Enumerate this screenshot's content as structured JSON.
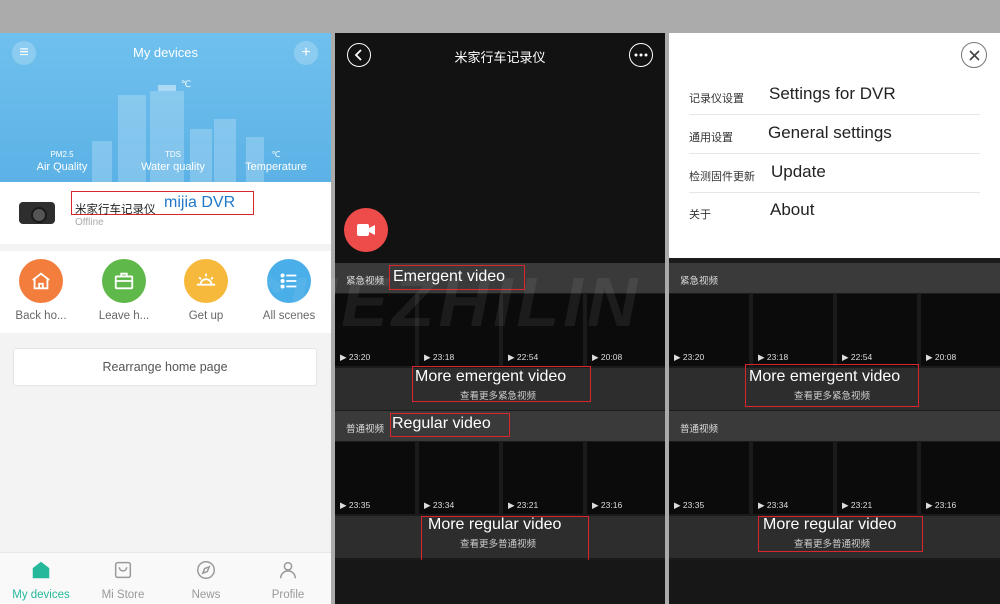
{
  "home": {
    "title": "My devices",
    "temp_unit": "℃",
    "metrics": [
      {
        "small": "PM2.5",
        "label": "Air Quality"
      },
      {
        "small": "TDS",
        "label": "Water quality"
      },
      {
        "small": "℃",
        "label": "Temperature"
      }
    ],
    "device": {
      "name_zh": "米家行车记录仪",
      "name_en": "mijia DVR",
      "status": "Offline"
    },
    "scenes": [
      {
        "label": "Back ho...",
        "color": "#f27d3d",
        "icon": "home-icon"
      },
      {
        "label": "Leave h...",
        "color": "#5fb94a",
        "icon": "briefcase-icon"
      },
      {
        "label": "Get up",
        "color": "#f6b93b",
        "icon": "sunrise-icon"
      },
      {
        "label": "All scenes",
        "color": "#4aaee8",
        "icon": "list-icon"
      }
    ],
    "rearrange": "Rearrange home page",
    "tabs": [
      {
        "label": "My devices",
        "icon": "house-icon",
        "active": true
      },
      {
        "label": "Mi Store",
        "icon": "store-icon",
        "active": false
      },
      {
        "label": "News",
        "icon": "compass-icon",
        "active": false
      },
      {
        "label": "Profile",
        "icon": "person-icon",
        "active": false
      }
    ]
  },
  "dvr": {
    "title": "米家行车记录仪",
    "emergent": {
      "label_zh": "紧急视频",
      "label_en": "Emergent video",
      "times": [
        "23:20",
        "23:18",
        "22:54",
        "20:08"
      ],
      "more_en": "More emergent video",
      "more_zh": "查看更多紧急视频"
    },
    "regular": {
      "label_zh": "普通视频",
      "label_en": "Regular video",
      "times": [
        "23:35",
        "23:34",
        "23:21",
        "23:16"
      ],
      "more_en": "More regular video",
      "more_zh": "查看更多普通视频"
    }
  },
  "menu": {
    "items": [
      {
        "zh": "记录仪设置",
        "en": "Settings for DVR"
      },
      {
        "zh": "通用设置",
        "en": "General settings"
      },
      {
        "zh": "检测固件更新",
        "en": "Update"
      },
      {
        "zh": "关于",
        "en": "About"
      }
    ]
  },
  "watermark": "CHEZHILIN",
  "colors": {
    "accent": "#25b89a",
    "annotation": "#d8262c",
    "hero": "#5cb2e6",
    "record": "#ee4b4b"
  }
}
